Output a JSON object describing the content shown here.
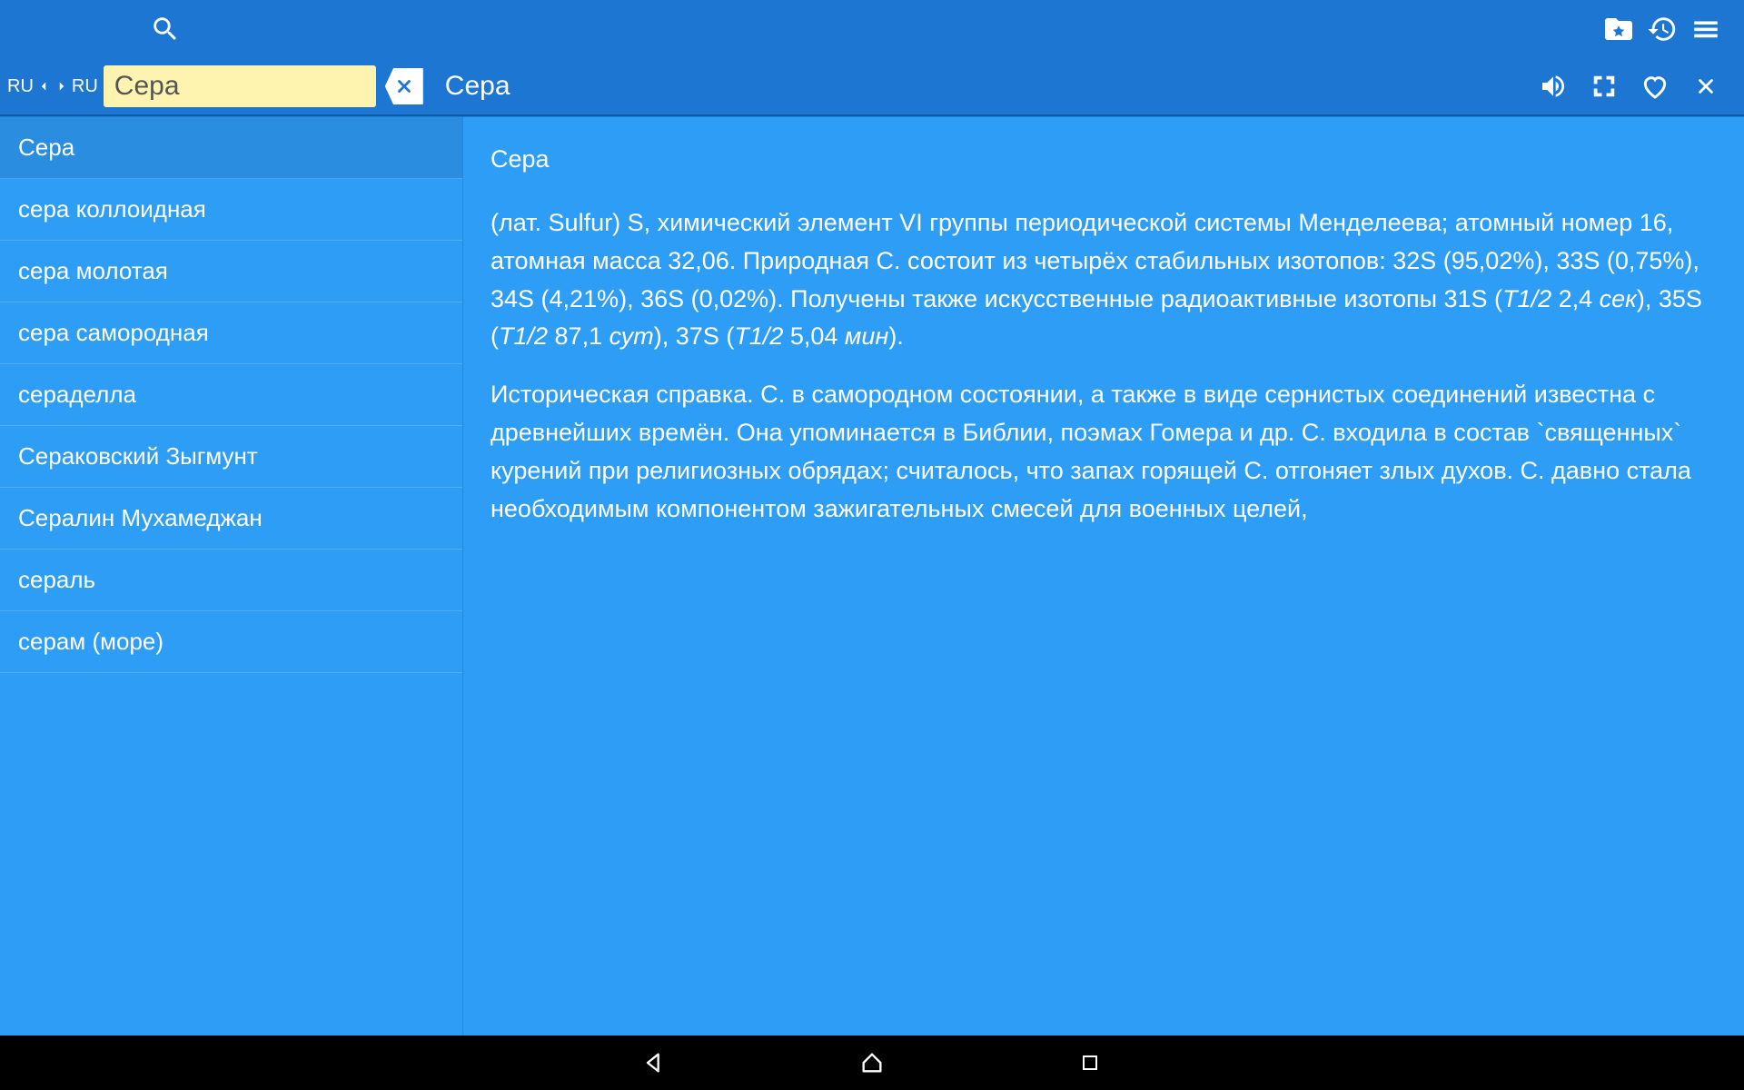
{
  "lang": {
    "from": "RU",
    "to": "RU"
  },
  "search": {
    "value": "Сера"
  },
  "headword": "Сера",
  "sidebar": {
    "items": [
      {
        "label": "Сера",
        "selected": true
      },
      {
        "label": "сера коллоидная"
      },
      {
        "label": "сера молотая"
      },
      {
        "label": "сера самородная"
      },
      {
        "label": "сераделла"
      },
      {
        "label": "Сераковский Зыгмунт"
      },
      {
        "label": "Сералин Мухамеджан"
      },
      {
        "label": "сераль"
      },
      {
        "label": "серам (море)"
      }
    ]
  },
  "article": {
    "title": "Сера",
    "p1_a": "(лат. Sulfur) S, химический элемент VI группы периодической системы Менделеева; атомный номер 16, атомная масса 32,06. Природная С. состоит из четырёх стабильных изотопов: 32S (95,02%), 33S (0,75%), 34S (4,21%), 36S (0,02%). Получены также искусственные радиоактивные изотопы 31S (",
    "t1": "T1/2",
    "p1_b": " 2,4 ",
    "u1": "сек",
    "p1_c": "), 35S (",
    "p1_d": " 87,1 ",
    "u2": "сут",
    "p1_e": "), 37S (",
    "p1_f": " 5,04 ",
    "u3": "мин",
    "p1_g": ").",
    "p2": "Историческая справка. С. в самородном состоянии, а также в виде сернистых соединений известна с древнейших времён. Она упоминается в Библии, поэмах Гомера и др. С. входила в состав `священных` курений при религиозных обрядах; считалось, что запах горящей С. отгоняет злых духов. С. давно стала необходимым компонентом зажигательных смесей для военных целей,"
  }
}
